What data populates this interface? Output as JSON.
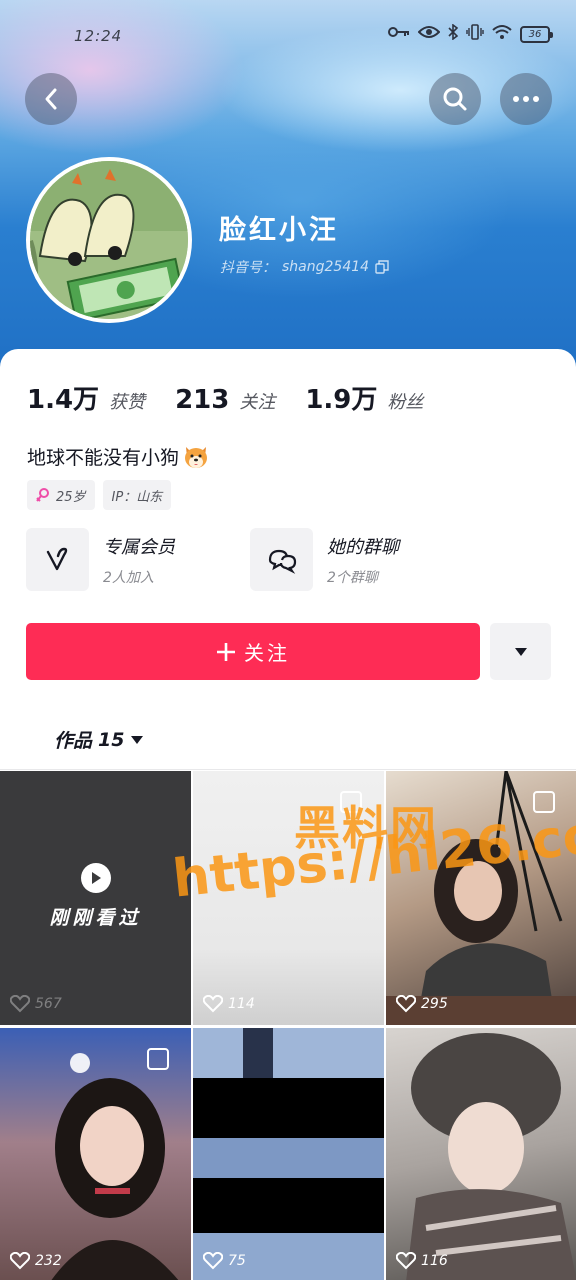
{
  "status_bar": {
    "time": "12:24",
    "battery": "36"
  },
  "profile": {
    "name": "脸红小汪",
    "handle_label": "抖音号：",
    "handle": "shang25414"
  },
  "stats": [
    {
      "value": "1.4万",
      "label": "获赞"
    },
    {
      "value": "213",
      "label": "关注"
    },
    {
      "value": "1.9万",
      "label": "粉丝"
    }
  ],
  "bio": "地球不能没有小狗",
  "tags": {
    "age": "25岁",
    "ip": "IP：山东"
  },
  "features": {
    "vip": {
      "title": "专属会员",
      "subtitle": "2人加入"
    },
    "group": {
      "title": "她的群聊",
      "subtitle": "2个群聊"
    }
  },
  "actions": {
    "follow_label": "关注"
  },
  "works_tab": {
    "label": "作品",
    "count": "15"
  },
  "grid": {
    "recently_watched_label": "刚刚看过",
    "items": [
      {
        "likes": "567"
      },
      {
        "likes": "114"
      },
      {
        "likes": "295"
      },
      {
        "likes": "232"
      },
      {
        "likes": "75"
      },
      {
        "likes": "116"
      }
    ]
  },
  "watermark": {
    "cn": "黑料网",
    "url": "https://hl26.co"
  },
  "colors": {
    "accent": "#fe2c55",
    "banner": "#2a7fd0"
  }
}
